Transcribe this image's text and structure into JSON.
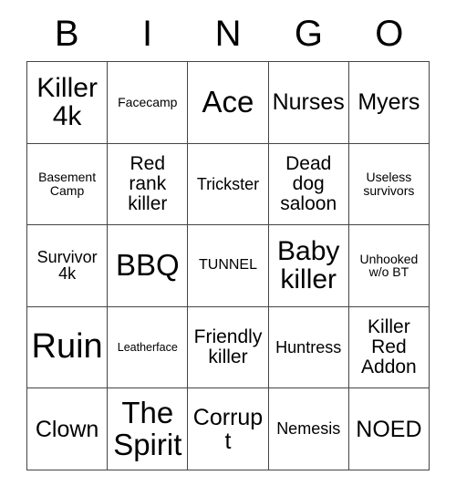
{
  "card": {
    "title": "BINGO",
    "header_letters": [
      "B",
      "I",
      "N",
      "G",
      "O"
    ],
    "colors": {
      "background": "#ffffff",
      "text": "#000000",
      "grid_line": "#444444"
    },
    "rows": [
      [
        {
          "label": "Killer 4k",
          "size": "lg"
        },
        {
          "label": "Facecamp",
          "size": "tiny"
        },
        {
          "label": "Ace",
          "size": "xl"
        },
        {
          "label": "Nurses",
          "size": "md"
        },
        {
          "label": "Myers",
          "size": "md"
        }
      ],
      [
        {
          "label": "Basement Camp",
          "size": "tiny"
        },
        {
          "label": "Red rank killer",
          "size": "sm"
        },
        {
          "label": "Trickster",
          "size": "xs"
        },
        {
          "label": "Dead dog saloon",
          "size": "sm"
        },
        {
          "label": "Useless survivors",
          "size": "tiny"
        }
      ],
      [
        {
          "label": "Survivor 4k",
          "size": "xs"
        },
        {
          "label": "BBQ",
          "size": "xl"
        },
        {
          "label": "TUNNEL",
          "size": "xxs"
        },
        {
          "label": "Baby killer",
          "size": "lg"
        },
        {
          "label": "Unhooked w/o BT",
          "size": "tiny"
        }
      ],
      [
        {
          "label": "Ruin",
          "size": "xxl"
        },
        {
          "label": "Leatherface",
          "size": "micro"
        },
        {
          "label": "Friendly killer",
          "size": "sm"
        },
        {
          "label": "Huntress",
          "size": "xs"
        },
        {
          "label": "Killer Red Addon",
          "size": "sm"
        }
      ],
      [
        {
          "label": "Clown",
          "size": "md"
        },
        {
          "label": "The Spirit",
          "size": "xl"
        },
        {
          "label": "Corrupt",
          "size": "md"
        },
        {
          "label": "Nemesis",
          "size": "xs"
        },
        {
          "label": "NOED",
          "size": "md"
        }
      ]
    ]
  }
}
